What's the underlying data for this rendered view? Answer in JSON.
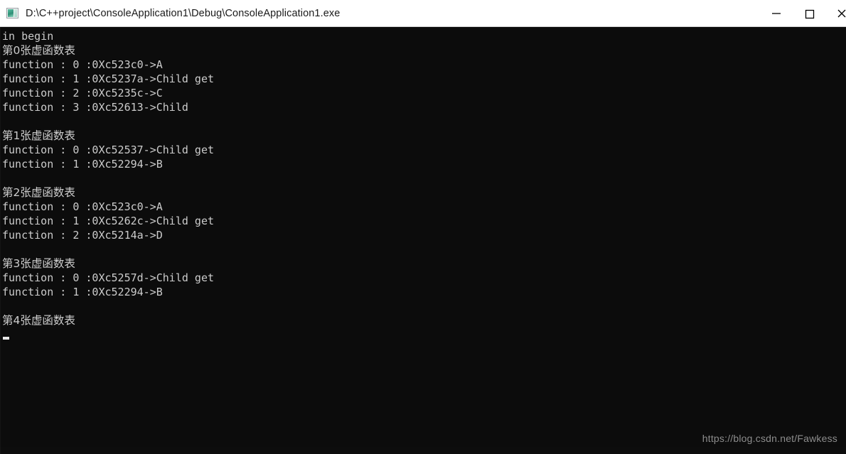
{
  "window": {
    "title": "D:\\C++project\\ConsoleApplication1\\Debug\\ConsoleApplication1.exe",
    "app_icon": "console-app-icon",
    "titlebar_bg": "#ffffff",
    "titlebar_fg": "#1a1a1a",
    "console_bg": "#0c0c0c",
    "console_fg": "#cccccc",
    "controls": {
      "minimize_label": "Minimize",
      "maximize_label": "Maximize",
      "close_label": "Close"
    }
  },
  "console": {
    "lines": [
      "in begin",
      "第0张虚函数表",
      "function : 0 :0Xc523c0->A",
      "function : 1 :0Xc5237a->Child get",
      "function : 2 :0Xc5235c->C",
      "function : 3 :0Xc52613->Child",
      "",
      "第1张虚函数表",
      "function : 0 :0Xc52537->Child get",
      "function : 1 :0Xc52294->B",
      "",
      "第2张虚函数表",
      "function : 0 :0Xc523c0->A",
      "function : 1 :0Xc5262c->Child get",
      "function : 2 :0Xc5214a->D",
      "",
      "第3张虚函数表",
      "function : 0 :0Xc5257d->Child get",
      "function : 1 :0Xc52294->B",
      "",
      "第4张虚函数表"
    ],
    "cursor_visible": true
  },
  "watermark": {
    "text": "https://blog.csdn.net/Fawkess"
  },
  "bottom_strip": {
    "ghost_text": " "
  }
}
